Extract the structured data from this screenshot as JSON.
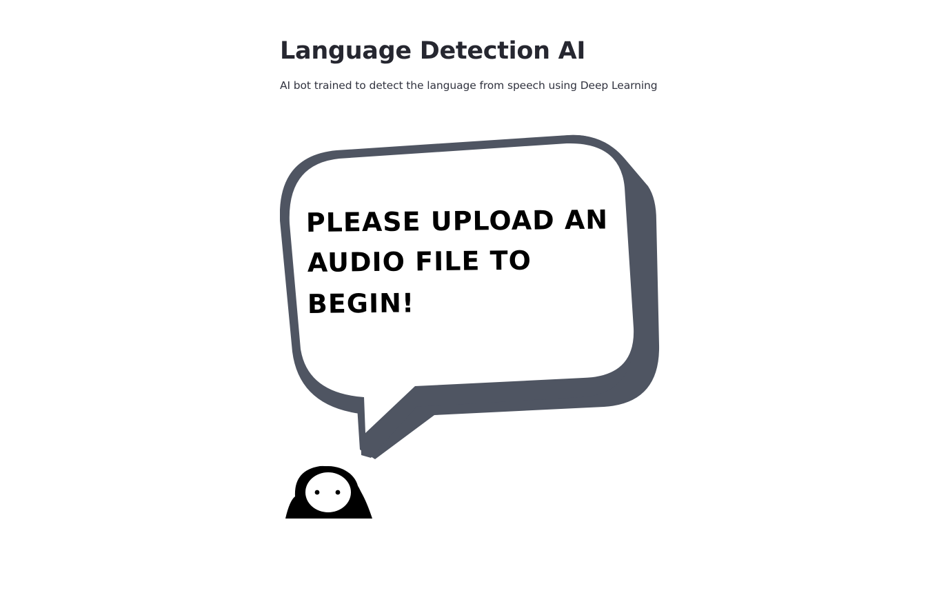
{
  "header": {
    "title": "Language Detection AI",
    "subtitle": "AI bot trained to detect the language from speech using Deep Learning"
  },
  "illustration": {
    "speech_bubble_lines": [
      "PLEASE UPLOAD AN",
      "AUDIO FILE TO",
      "BEGIN!"
    ],
    "bubble_outline_color": "#4f5562",
    "bubble_fill_color": "#ffffff",
    "character_color": "#000000"
  }
}
